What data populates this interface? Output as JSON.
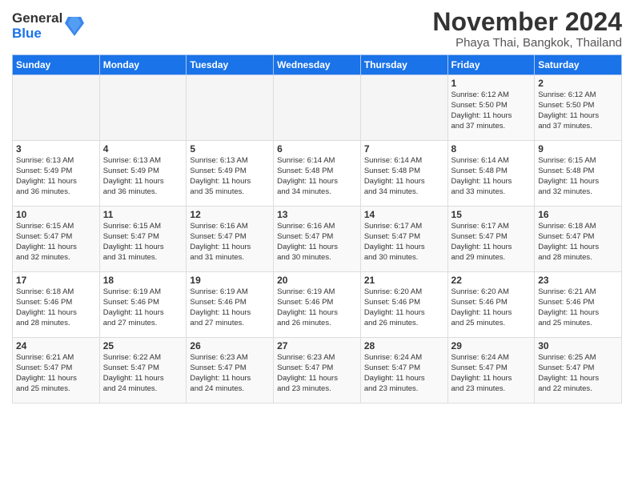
{
  "logo": {
    "line1": "General",
    "line2": "Blue"
  },
  "title": "November 2024",
  "subtitle": "Phaya Thai, Bangkok, Thailand",
  "days_of_week": [
    "Sunday",
    "Monday",
    "Tuesday",
    "Wednesday",
    "Thursday",
    "Friday",
    "Saturday"
  ],
  "weeks": [
    [
      {
        "day": "",
        "info": ""
      },
      {
        "day": "",
        "info": ""
      },
      {
        "day": "",
        "info": ""
      },
      {
        "day": "",
        "info": ""
      },
      {
        "day": "",
        "info": ""
      },
      {
        "day": "1",
        "info": "Sunrise: 6:12 AM\nSunset: 5:50 PM\nDaylight: 11 hours\nand 37 minutes."
      },
      {
        "day": "2",
        "info": "Sunrise: 6:12 AM\nSunset: 5:50 PM\nDaylight: 11 hours\nand 37 minutes."
      }
    ],
    [
      {
        "day": "3",
        "info": "Sunrise: 6:13 AM\nSunset: 5:49 PM\nDaylight: 11 hours\nand 36 minutes."
      },
      {
        "day": "4",
        "info": "Sunrise: 6:13 AM\nSunset: 5:49 PM\nDaylight: 11 hours\nand 36 minutes."
      },
      {
        "day": "5",
        "info": "Sunrise: 6:13 AM\nSunset: 5:49 PM\nDaylight: 11 hours\nand 35 minutes."
      },
      {
        "day": "6",
        "info": "Sunrise: 6:14 AM\nSunset: 5:48 PM\nDaylight: 11 hours\nand 34 minutes."
      },
      {
        "day": "7",
        "info": "Sunrise: 6:14 AM\nSunset: 5:48 PM\nDaylight: 11 hours\nand 34 minutes."
      },
      {
        "day": "8",
        "info": "Sunrise: 6:14 AM\nSunset: 5:48 PM\nDaylight: 11 hours\nand 33 minutes."
      },
      {
        "day": "9",
        "info": "Sunrise: 6:15 AM\nSunset: 5:48 PM\nDaylight: 11 hours\nand 32 minutes."
      }
    ],
    [
      {
        "day": "10",
        "info": "Sunrise: 6:15 AM\nSunset: 5:47 PM\nDaylight: 11 hours\nand 32 minutes."
      },
      {
        "day": "11",
        "info": "Sunrise: 6:15 AM\nSunset: 5:47 PM\nDaylight: 11 hours\nand 31 minutes."
      },
      {
        "day": "12",
        "info": "Sunrise: 6:16 AM\nSunset: 5:47 PM\nDaylight: 11 hours\nand 31 minutes."
      },
      {
        "day": "13",
        "info": "Sunrise: 6:16 AM\nSunset: 5:47 PM\nDaylight: 11 hours\nand 30 minutes."
      },
      {
        "day": "14",
        "info": "Sunrise: 6:17 AM\nSunset: 5:47 PM\nDaylight: 11 hours\nand 30 minutes."
      },
      {
        "day": "15",
        "info": "Sunrise: 6:17 AM\nSunset: 5:47 PM\nDaylight: 11 hours\nand 29 minutes."
      },
      {
        "day": "16",
        "info": "Sunrise: 6:18 AM\nSunset: 5:47 PM\nDaylight: 11 hours\nand 28 minutes."
      }
    ],
    [
      {
        "day": "17",
        "info": "Sunrise: 6:18 AM\nSunset: 5:46 PM\nDaylight: 11 hours\nand 28 minutes."
      },
      {
        "day": "18",
        "info": "Sunrise: 6:19 AM\nSunset: 5:46 PM\nDaylight: 11 hours\nand 27 minutes."
      },
      {
        "day": "19",
        "info": "Sunrise: 6:19 AM\nSunset: 5:46 PM\nDaylight: 11 hours\nand 27 minutes."
      },
      {
        "day": "20",
        "info": "Sunrise: 6:19 AM\nSunset: 5:46 PM\nDaylight: 11 hours\nand 26 minutes."
      },
      {
        "day": "21",
        "info": "Sunrise: 6:20 AM\nSunset: 5:46 PM\nDaylight: 11 hours\nand 26 minutes."
      },
      {
        "day": "22",
        "info": "Sunrise: 6:20 AM\nSunset: 5:46 PM\nDaylight: 11 hours\nand 25 minutes."
      },
      {
        "day": "23",
        "info": "Sunrise: 6:21 AM\nSunset: 5:46 PM\nDaylight: 11 hours\nand 25 minutes."
      }
    ],
    [
      {
        "day": "24",
        "info": "Sunrise: 6:21 AM\nSunset: 5:47 PM\nDaylight: 11 hours\nand 25 minutes."
      },
      {
        "day": "25",
        "info": "Sunrise: 6:22 AM\nSunset: 5:47 PM\nDaylight: 11 hours\nand 24 minutes."
      },
      {
        "day": "26",
        "info": "Sunrise: 6:23 AM\nSunset: 5:47 PM\nDaylight: 11 hours\nand 24 minutes."
      },
      {
        "day": "27",
        "info": "Sunrise: 6:23 AM\nSunset: 5:47 PM\nDaylight: 11 hours\nand 23 minutes."
      },
      {
        "day": "28",
        "info": "Sunrise: 6:24 AM\nSunset: 5:47 PM\nDaylight: 11 hours\nand 23 minutes."
      },
      {
        "day": "29",
        "info": "Sunrise: 6:24 AM\nSunset: 5:47 PM\nDaylight: 11 hours\nand 23 minutes."
      },
      {
        "day": "30",
        "info": "Sunrise: 6:25 AM\nSunset: 5:47 PM\nDaylight: 11 hours\nand 22 minutes."
      }
    ]
  ]
}
